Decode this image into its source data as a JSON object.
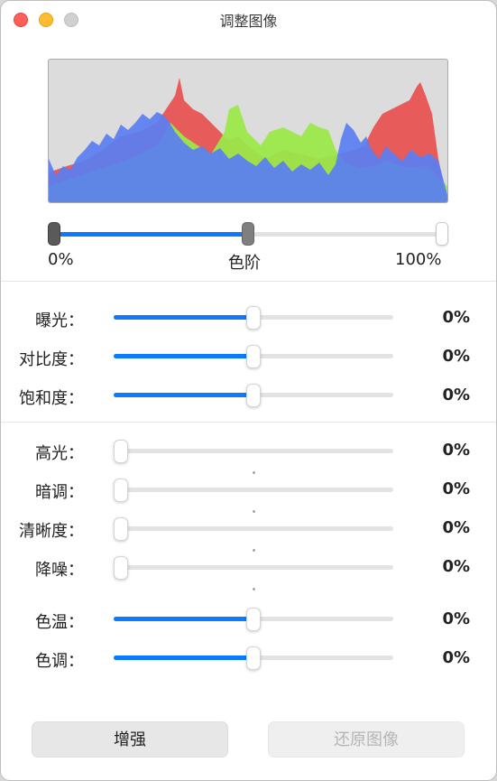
{
  "window": {
    "title": "调整图像"
  },
  "levels": {
    "min_label": "0%",
    "mid_label": "色阶",
    "max_label": "100%",
    "mid_position": 0.5
  },
  "adjustments": {
    "exposure": {
      "label": "曝光：",
      "value": "0%",
      "level": 0.5
    },
    "contrast": {
      "label": "对比度：",
      "value": "0%",
      "level": 0.5
    },
    "saturation": {
      "label": "饱和度：",
      "value": "0%",
      "level": 0.5
    },
    "highlights": {
      "label": "高光：",
      "value": "0%",
      "level": 0.0
    },
    "shadows": {
      "label": "暗调：",
      "value": "0%",
      "level": 0.0
    },
    "sharpness": {
      "label": "清晰度：",
      "value": "0%",
      "level": 0.0
    },
    "noise": {
      "label": "降噪：",
      "value": "0%",
      "level": 0.0
    },
    "temperature": {
      "label": "色温：",
      "value": "0%",
      "level": 0.5
    },
    "tint": {
      "label": "色调：",
      "value": "0%",
      "level": 0.5
    }
  },
  "buttons": {
    "enhance": "增强",
    "revert": "还原图像"
  },
  "colors": {
    "accent": "#0a7bff",
    "red": "#e84c4c",
    "green": "#9be84a",
    "blue": "#5a7ef2"
  }
}
